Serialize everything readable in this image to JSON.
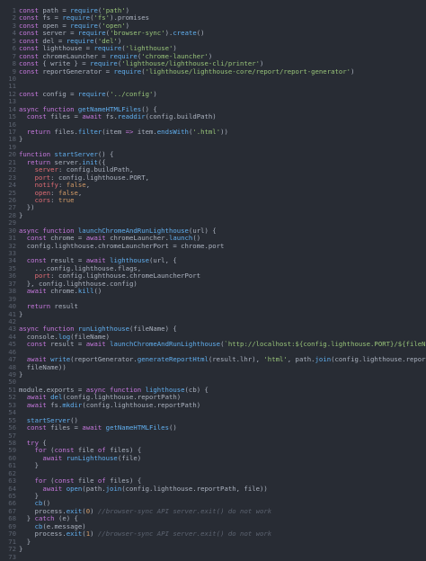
{
  "theme": {
    "background": "#282c34",
    "gutter": "#5c6370",
    "text": "#abb2bf",
    "keyword": "#c678dd",
    "string": "#98c379",
    "function": "#61afef",
    "number": "#d19a66",
    "property": "#e06c75",
    "variable": "#e5c07b",
    "comment": "#5c6370",
    "operator": "#56b6c2"
  },
  "lines": [
    [
      [
        "kw",
        "const "
      ],
      [
        "pl",
        "path = "
      ],
      [
        "fn",
        "require"
      ],
      [
        "pl",
        "("
      ],
      [
        "str",
        "'path'"
      ],
      [
        "pl",
        ")"
      ]
    ],
    [
      [
        "kw",
        "const "
      ],
      [
        "pl",
        "fs = "
      ],
      [
        "fn",
        "require"
      ],
      [
        "pl",
        "("
      ],
      [
        "str",
        "'fs'"
      ],
      [
        "pl",
        ").promises"
      ]
    ],
    [
      [
        "kw",
        "const "
      ],
      [
        "pl",
        "open = "
      ],
      [
        "fn",
        "require"
      ],
      [
        "pl",
        "("
      ],
      [
        "str",
        "'open'"
      ],
      [
        "pl",
        ")"
      ]
    ],
    [
      [
        "kw",
        "const "
      ],
      [
        "pl",
        "server = "
      ],
      [
        "fn",
        "require"
      ],
      [
        "pl",
        "("
      ],
      [
        "str",
        "'browser-sync'"
      ],
      [
        "pl",
        ")."
      ],
      [
        "fn",
        "create"
      ],
      [
        "pl",
        "()"
      ]
    ],
    [
      [
        "kw",
        "const "
      ],
      [
        "pl",
        "del = "
      ],
      [
        "fn",
        "require"
      ],
      [
        "pl",
        "("
      ],
      [
        "str",
        "'del'"
      ],
      [
        "pl",
        ")"
      ]
    ],
    [
      [
        "kw",
        "const "
      ],
      [
        "pl",
        "lighthouse = "
      ],
      [
        "fn",
        "require"
      ],
      [
        "pl",
        "("
      ],
      [
        "str",
        "'lighthouse'"
      ],
      [
        "pl",
        ")"
      ]
    ],
    [
      [
        "kw",
        "const "
      ],
      [
        "pl",
        "chromeLauncher = "
      ],
      [
        "fn",
        "require"
      ],
      [
        "pl",
        "("
      ],
      [
        "str",
        "'chrome-launcher'"
      ],
      [
        "pl",
        ")"
      ]
    ],
    [
      [
        "kw",
        "const "
      ],
      [
        "pl",
        "{ write } = "
      ],
      [
        "fn",
        "require"
      ],
      [
        "pl",
        "("
      ],
      [
        "str",
        "'lighthouse/lighthouse-cli/printer'"
      ],
      [
        "pl",
        ")"
      ]
    ],
    [
      [
        "kw",
        "const "
      ],
      [
        "pl",
        "reportGenerator = "
      ],
      [
        "fn",
        "require"
      ],
      [
        "pl",
        "("
      ],
      [
        "str",
        "'lighthouse/lighthouse-core/report/report-generator'"
      ],
      [
        "pl",
        ")"
      ]
    ],
    [],
    [],
    [
      [
        "kw",
        "const "
      ],
      [
        "pl",
        "config = "
      ],
      [
        "fn",
        "require"
      ],
      [
        "pl",
        "("
      ],
      [
        "str",
        "'../config'"
      ],
      [
        "pl",
        ")"
      ]
    ],
    [],
    [
      [
        "kw",
        "async function "
      ],
      [
        "fn",
        "getNameHTMLFiles"
      ],
      [
        "pl",
        "() {"
      ]
    ],
    [
      [
        "kw",
        "  const "
      ],
      [
        "pl",
        "files = "
      ],
      [
        "kw",
        "await "
      ],
      [
        "pl",
        "fs."
      ],
      [
        "fn",
        "readdir"
      ],
      [
        "pl",
        "(config.buildPath)"
      ]
    ],
    [],
    [
      [
        "kw",
        "  return "
      ],
      [
        "pl",
        "files."
      ],
      [
        "fn",
        "filter"
      ],
      [
        "pl",
        "(item "
      ],
      [
        "kw",
        "=>"
      ],
      [
        "pl",
        " item."
      ],
      [
        "fn",
        "endsWith"
      ],
      [
        "pl",
        "("
      ],
      [
        "str",
        "'.html'"
      ],
      [
        "pl",
        "))"
      ]
    ],
    [
      [
        "pl",
        "}"
      ]
    ],
    [],
    [
      [
        "kw",
        "function "
      ],
      [
        "fn",
        "startServer"
      ],
      [
        "pl",
        "() {"
      ]
    ],
    [
      [
        "kw",
        "  return "
      ],
      [
        "pl",
        "server."
      ],
      [
        "fn",
        "init"
      ],
      [
        "pl",
        "({"
      ]
    ],
    [
      [
        "prop",
        "    server"
      ],
      [
        "pl",
        ": config.buildPath,"
      ]
    ],
    [
      [
        "prop",
        "    port"
      ],
      [
        "pl",
        ": config.lighthouse.PORT,"
      ]
    ],
    [
      [
        "prop",
        "    notify"
      ],
      [
        "pl",
        ": "
      ],
      [
        "num",
        "false"
      ],
      [
        "pl",
        ","
      ]
    ],
    [
      [
        "prop",
        "    open"
      ],
      [
        "pl",
        ": "
      ],
      [
        "num",
        "false"
      ],
      [
        "pl",
        ","
      ]
    ],
    [
      [
        "prop",
        "    cors"
      ],
      [
        "pl",
        ": "
      ],
      [
        "num",
        "true"
      ]
    ],
    [
      [
        "pl",
        "  })"
      ]
    ],
    [
      [
        "pl",
        "}"
      ]
    ],
    [],
    [
      [
        "kw",
        "async function "
      ],
      [
        "fn",
        "launchChromeAndRunLighthouse"
      ],
      [
        "pl",
        "(url) {"
      ]
    ],
    [
      [
        "kw",
        "  const "
      ],
      [
        "pl",
        "chrome = "
      ],
      [
        "kw",
        "await "
      ],
      [
        "pl",
        "chromeLauncher."
      ],
      [
        "fn",
        "launch"
      ],
      [
        "pl",
        "()"
      ]
    ],
    [
      [
        "pl",
        "  config.lighthouse.chromeLauncherPort = chrome.port"
      ]
    ],
    [],
    [
      [
        "kw",
        "  const "
      ],
      [
        "pl",
        "result = "
      ],
      [
        "kw",
        "await "
      ],
      [
        "fn",
        "lighthouse"
      ],
      [
        "pl",
        "(url, {"
      ]
    ],
    [
      [
        "pl",
        "    ...config.lighthouse.flags,"
      ]
    ],
    [
      [
        "prop",
        "    port"
      ],
      [
        "pl",
        ": config.lighthouse.chromeLauncherPort"
      ]
    ],
    [
      [
        "pl",
        "  }, config.lighthouse.config)"
      ]
    ],
    [
      [
        "kw",
        "  await "
      ],
      [
        "pl",
        "chrome."
      ],
      [
        "fn",
        "kill"
      ],
      [
        "pl",
        "()"
      ]
    ],
    [],
    [
      [
        "kw",
        "  return "
      ],
      [
        "pl",
        "result"
      ]
    ],
    [
      [
        "pl",
        "}"
      ]
    ],
    [],
    [
      [
        "kw",
        "async function "
      ],
      [
        "fn",
        "runLighthouse"
      ],
      [
        "pl",
        "(fileName) {"
      ]
    ],
    [
      [
        "pl",
        "  console."
      ],
      [
        "fn",
        "log"
      ],
      [
        "pl",
        "(fileName)"
      ]
    ],
    [
      [
        "kw",
        "  const "
      ],
      [
        "pl",
        "result = "
      ],
      [
        "kw",
        "await "
      ],
      [
        "fn",
        "launchChromeAndRunLighthouse"
      ],
      [
        "pl",
        "("
      ],
      [
        "str",
        "`http://localhost:${config.lighthouse.PORT}/${fileName}`"
      ],
      [
        "pl",
        ")"
      ]
    ],
    [],
    [
      [
        "kw",
        "  await "
      ],
      [
        "fn",
        "write"
      ],
      [
        "pl",
        "(reportGenerator."
      ],
      [
        "fn",
        "generateReportHtml"
      ],
      [
        "pl",
        "(result.lhr), "
      ],
      [
        "str",
        "'html'"
      ],
      [
        "pl",
        ", path."
      ],
      [
        "fn",
        "join"
      ],
      [
        "pl",
        "(config.lighthouse.reportPath,"
      ]
    ],
    [
      [
        "pl",
        "  fileName))"
      ]
    ],
    [
      [
        "pl",
        "}"
      ]
    ],
    [],
    [
      [
        "pl",
        "module.exports = "
      ],
      [
        "kw",
        "async function "
      ],
      [
        "fn",
        "lighthouse"
      ],
      [
        "pl",
        "(cb) {"
      ]
    ],
    [
      [
        "kw",
        "  await "
      ],
      [
        "fn",
        "del"
      ],
      [
        "pl",
        "(config.lighthouse.reportPath)"
      ]
    ],
    [
      [
        "kw",
        "  await "
      ],
      [
        "pl",
        "fs."
      ],
      [
        "fn",
        "mkdir"
      ],
      [
        "pl",
        "(config.lighthouse.reportPath)"
      ]
    ],
    [],
    [
      [
        "fn",
        "  startServer"
      ],
      [
        "pl",
        "()"
      ]
    ],
    [
      [
        "kw",
        "  const "
      ],
      [
        "pl",
        "files = "
      ],
      [
        "kw",
        "await "
      ],
      [
        "fn",
        "getNameHTMLFiles"
      ],
      [
        "pl",
        "()"
      ]
    ],
    [],
    [
      [
        "kw",
        "  try "
      ],
      [
        "pl",
        "{"
      ]
    ],
    [
      [
        "kw",
        "    for "
      ],
      [
        "pl",
        "("
      ],
      [
        "kw",
        "const "
      ],
      [
        "pl",
        "file "
      ],
      [
        "kw",
        "of "
      ],
      [
        "pl",
        "files) {"
      ]
    ],
    [
      [
        "kw",
        "      await "
      ],
      [
        "fn",
        "runLighthouse"
      ],
      [
        "pl",
        "(file)"
      ]
    ],
    [
      [
        "pl",
        "    }"
      ]
    ],
    [],
    [
      [
        "kw",
        "    for "
      ],
      [
        "pl",
        "("
      ],
      [
        "kw",
        "const "
      ],
      [
        "pl",
        "file "
      ],
      [
        "kw",
        "of "
      ],
      [
        "pl",
        "files) {"
      ]
    ],
    [
      [
        "kw",
        "      await "
      ],
      [
        "fn",
        "open"
      ],
      [
        "pl",
        "(path."
      ],
      [
        "fn",
        "join"
      ],
      [
        "pl",
        "(config.lighthouse.reportPath, file))"
      ]
    ],
    [
      [
        "pl",
        "    }"
      ]
    ],
    [
      [
        "fn",
        "    cb"
      ],
      [
        "pl",
        "()"
      ]
    ],
    [
      [
        "pl",
        "    process."
      ],
      [
        "fn",
        "exit"
      ],
      [
        "pl",
        "("
      ],
      [
        "num",
        "0"
      ],
      [
        "pl",
        ") "
      ],
      [
        "cm",
        "//browser-sync API server.exit() do not work"
      ]
    ],
    [
      [
        "pl",
        "  } "
      ],
      [
        "kw",
        "catch "
      ],
      [
        "pl",
        "(e) {"
      ]
    ],
    [
      [
        "fn",
        "    cb"
      ],
      [
        "pl",
        "(e.message)"
      ]
    ],
    [
      [
        "pl",
        "    process."
      ],
      [
        "fn",
        "exit"
      ],
      [
        "pl",
        "("
      ],
      [
        "num",
        "1"
      ],
      [
        "pl",
        ") "
      ],
      [
        "cm",
        "//browser-sync API server.exit() do not work"
      ]
    ],
    [
      [
        "pl",
        "  }"
      ]
    ],
    [
      [
        "pl",
        "}"
      ]
    ],
    []
  ]
}
